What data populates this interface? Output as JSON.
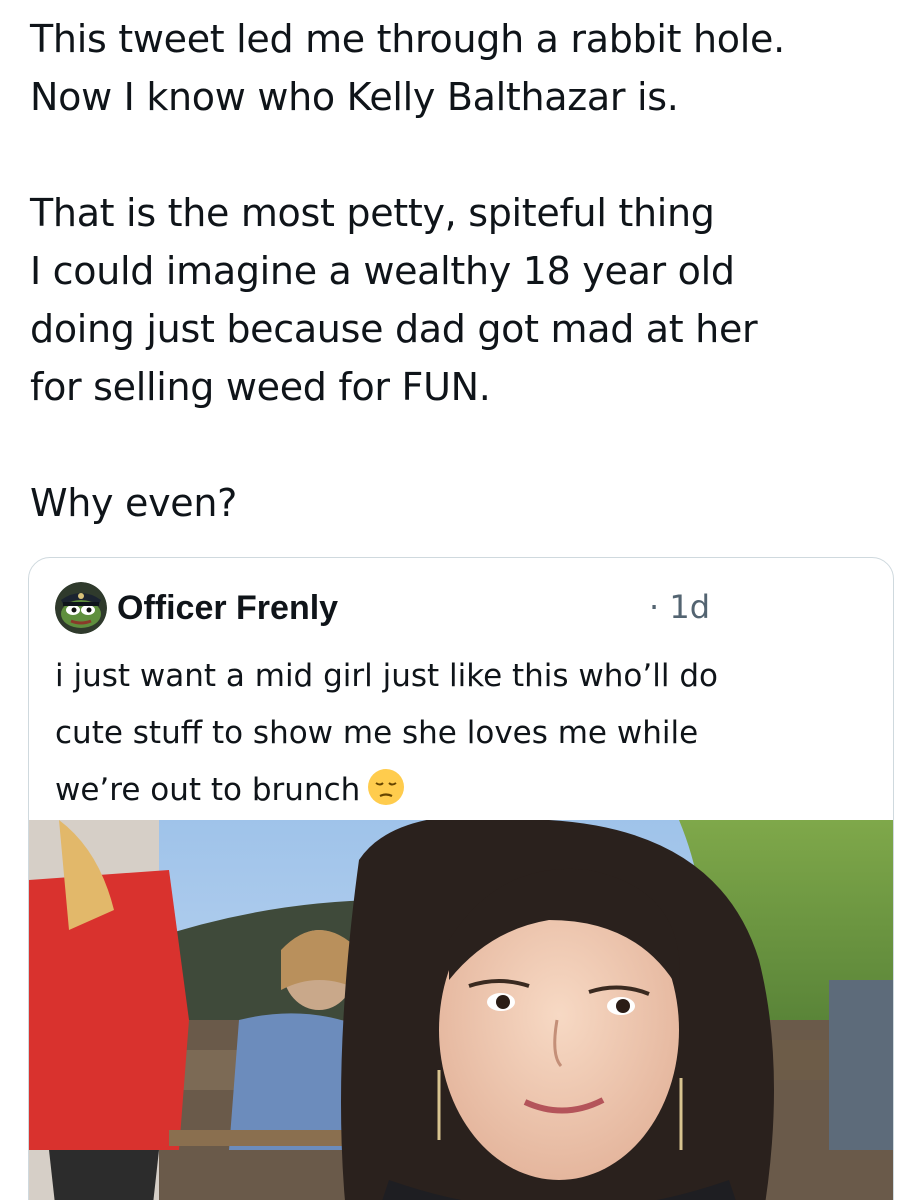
{
  "tweet": {
    "paragraph_1": "This tweet led me through a rabbit hole.\nNow I know who Kelly Balthazar is.",
    "paragraph_2": "That is the most petty, spiteful thing\nI could imagine a wealthy 18 year old\ndoing just because dad got mad at her\nfor selling weed for FUN.",
    "paragraph_3": "Why even?"
  },
  "quoted_tweet": {
    "author_name": "Officer Frenly",
    "time": "· 1d",
    "text_line_1": "i just want a mid girl just like this who’ll do",
    "text_line_2": "cute stuff to show me she loves me while",
    "text_line_3": "we’re out to brunch",
    "emoji": "pensive-face-emoji",
    "avatar_icon": "pepe-officer-avatar",
    "media": "outdoor-brunch-photo"
  },
  "colors": {
    "text": "#0f1419",
    "secondary_text": "#536471",
    "card_border": "#cfd9de"
  }
}
